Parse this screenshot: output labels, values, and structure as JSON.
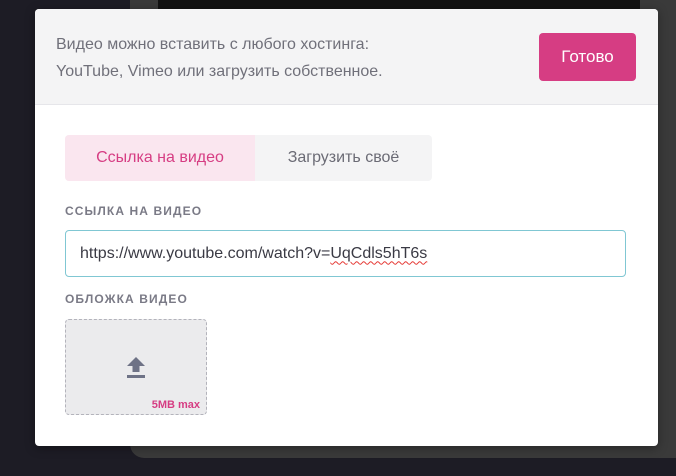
{
  "header": {
    "description_line1": "Видео можно вставить с любого хостинга:",
    "description_line2": "YouTube, Vimeo или загрузить собственное.",
    "done_label": "Готово"
  },
  "tabs": [
    {
      "label": "Ссылка на видео",
      "active": true
    },
    {
      "label": "Загрузить своё",
      "active": false
    }
  ],
  "video_link": {
    "label": "ССЫЛКА НА ВИДЕО",
    "value_prefix": "https://www.youtube.com/watch?v=",
    "value_id": "UqCdls5hT6s"
  },
  "cover": {
    "label": "ОБЛОЖКА ВИДЕО",
    "size_hint": "5MB max",
    "icon": "upload-icon"
  },
  "colors": {
    "accent": "#d63d83",
    "active_tab_bg": "#fae6ef",
    "focus_border": "#80c7d3"
  }
}
